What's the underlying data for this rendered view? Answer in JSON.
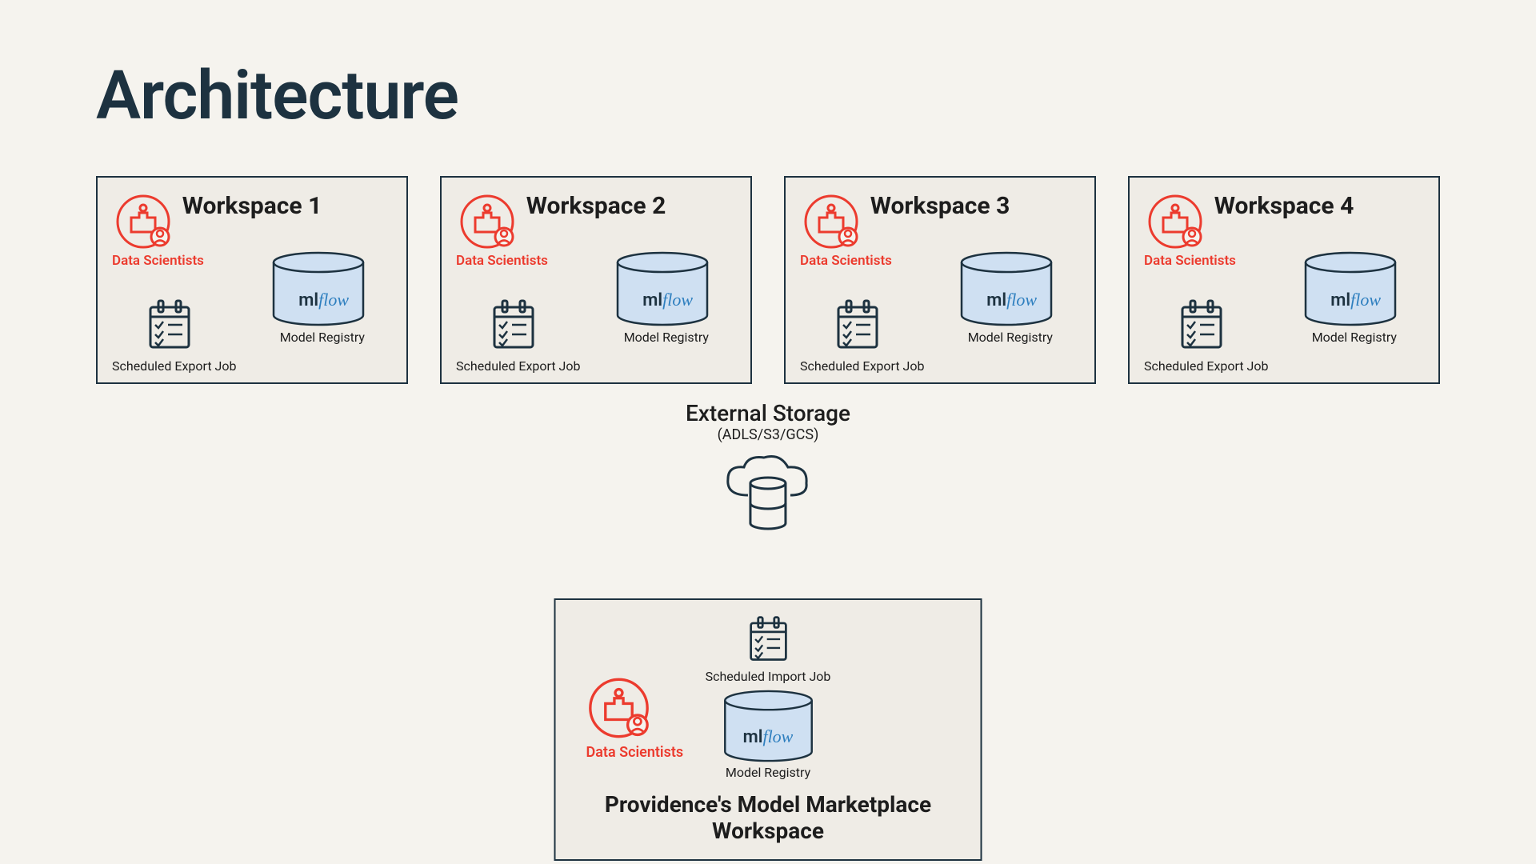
{
  "title": "Architecture",
  "workspaces": [
    {
      "title": "Workspace 1",
      "ds_label": "Data Scientists",
      "export_label": "Scheduled Export Job",
      "mr_label": "Model Registry"
    },
    {
      "title": "Workspace 2",
      "ds_label": "Data Scientists",
      "export_label": "Scheduled Export Job",
      "mr_label": "Model Registry"
    },
    {
      "title": "Workspace 3",
      "ds_label": "Data Scientists",
      "export_label": "Scheduled Export Job",
      "mr_label": "Model Registry"
    },
    {
      "title": "Workspace 4",
      "ds_label": "Data Scientists",
      "export_label": "Scheduled Export Job",
      "mr_label": "Model Registry"
    }
  ],
  "external": {
    "title": "External Storage",
    "subtitle": "(ADLS/S3/GCS)"
  },
  "marketplace": {
    "import_label": "Scheduled Import Job",
    "ds_label": "Data Scientists",
    "mr_label": "Model Registry",
    "title": "Providence's Model Marketplace Workspace"
  },
  "mlflow_ml": "ml",
  "mlflow_flow": "flow"
}
